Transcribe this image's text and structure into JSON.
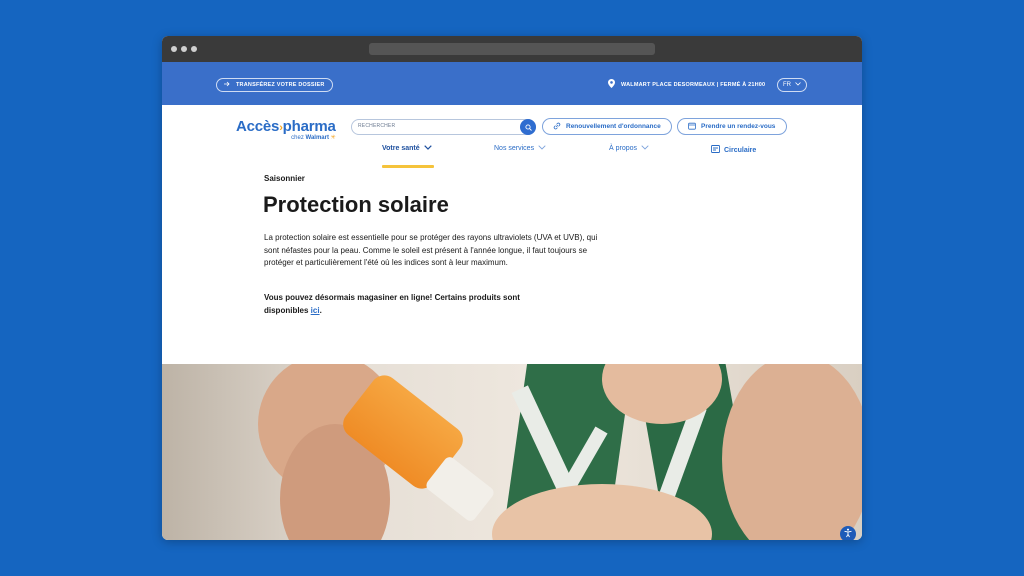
{
  "topbar": {
    "transfer_label": "TRANSFÉREZ VOTRE DOSSIER",
    "store_label": "WALMART PLACE DESORMEAUX | FERMÉ À 21H00",
    "lang": "FR"
  },
  "logo": {
    "part1": "Accès",
    "part2": "pharma",
    "sub_prefix": "chez",
    "sub_brand": "Walmart"
  },
  "search": {
    "placeholder": "RECHERCHER"
  },
  "actions": {
    "renew": "Renouvellement d'ordonnance",
    "appointment": "Prendre un rendez-vous"
  },
  "nav": {
    "items": [
      {
        "label": "Votre santé"
      },
      {
        "label": "Nos services"
      },
      {
        "label": "À propos"
      },
      {
        "label": "Circulaire"
      }
    ]
  },
  "content": {
    "eyebrow": "Saisonnier",
    "title": "Protection solaire",
    "paragraph": "La protection solaire est essentielle pour se protéger des rayons ultraviolets (UVA et UVB), qui sont néfastes pour la peau. Comme le soleil est présent à l'année longue, il faut toujours se protéger et particulièrement l'été où les indices sont à leur maximum.",
    "shop_text": "Vous pouvez désormais magasiner en ligne! Certains produits sont disponibles ",
    "shop_link": "ici",
    "shop_end": "."
  },
  "colors": {
    "page_bg": "#1565c0",
    "topbar": "#3a6fc9",
    "brand_blue": "#2a6cc6",
    "accent_yellow": "#f5c33b"
  }
}
